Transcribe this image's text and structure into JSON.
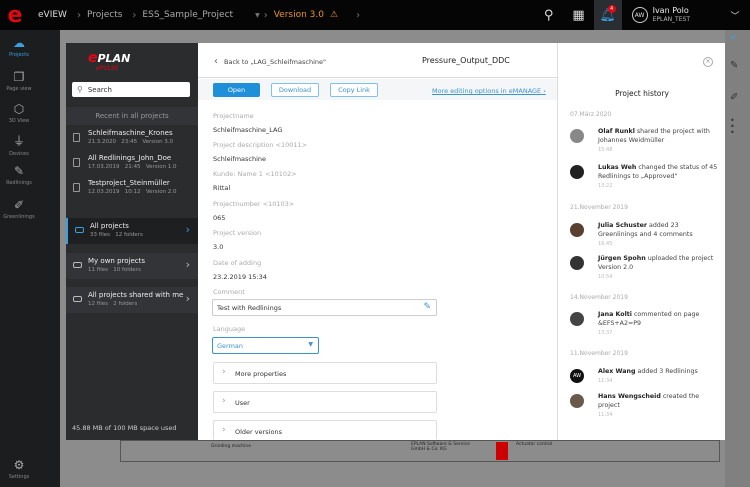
{
  "topbar": {
    "logo": "e",
    "app": "eVIEW",
    "crumbs": [
      "Projects",
      "ESS_Sample_Project"
    ],
    "version": "Version 3.0",
    "notification_count": "4",
    "user_initials": "AW",
    "user_name": "Ivan Polo",
    "user_org": "EPLAN_TEST"
  },
  "rail": {
    "items": [
      {
        "label": "Projects",
        "icon": "cloud-icon"
      },
      {
        "label": "Page view",
        "icon": "pages-icon"
      },
      {
        "label": "3D View",
        "icon": "cube-icon"
      },
      {
        "label": "Devices",
        "icon": "plug-icon"
      },
      {
        "label": "Redlinings",
        "icon": "marker-icon"
      },
      {
        "label": "Greenlinings",
        "icon": "pen-icon"
      }
    ],
    "settings": "Settings"
  },
  "left_panel": {
    "logo": "EPLAN",
    "logo_sub": "ePULSE",
    "search_placeholder": "Search",
    "recent_header": "Recent in all projects",
    "recent": [
      {
        "name": "Schleifmaschine_Krones",
        "meta": "21.3.2020   23:45   Version 3.0"
      },
      {
        "name": "All Redlinings_John_Doe",
        "meta": "17.03.2019   21:45   Version 1.0"
      },
      {
        "name": "Testproject_Steinmüller",
        "meta": "12.03.2019   10:12   Version 2.0"
      }
    ],
    "projects": [
      {
        "name": "All projects",
        "meta": "33 files   12 folders"
      },
      {
        "name": "My own projects",
        "meta": "11 files   10 folders"
      },
      {
        "name": "All projects shared with me",
        "meta": "12 files   2 folders"
      }
    ],
    "space": "45.88 MB of 100 MB space used"
  },
  "dialog": {
    "back": "Back to „LAG_Schleifmaschine\"",
    "title": "Pressure_Output_DDC",
    "buttons": {
      "open": "Open",
      "download": "Download",
      "copy": "Copy Link"
    },
    "more_link": "More editing options in eMANAGE",
    "fields": [
      {
        "label": "Projectname",
        "value": "Schleifmaschine_LAG"
      },
      {
        "label": "Project description <10011>",
        "value": "Schleifmaschine"
      },
      {
        "label": "Kunde: Name 1 <10102>",
        "value": "Rittal"
      },
      {
        "label": "Projectnumber <10103>",
        "value": "065"
      },
      {
        "label": "Project version",
        "value": "3.0"
      },
      {
        "label": "Date of adding",
        "value": "23.2.2019     15:34"
      }
    ],
    "comment_label": "Comment",
    "comment_value": "Test with Redlinings",
    "language_label": "Language",
    "language_value": "German",
    "accordions": [
      "More properties",
      "User",
      "Older versions"
    ]
  },
  "history": {
    "title": "Project history",
    "groups": [
      {
        "date": "07.März 2020",
        "entries": [
          {
            "name": "Olaf Runkl",
            "text": " shared the project with Johannes Weidmüller",
            "time": "15:48"
          },
          {
            "name": "Lukas Weh",
            "text": " changed the status of 45 Redlinings to „Approved\"",
            "time": "13:22"
          }
        ]
      },
      {
        "date": "21.November 2019",
        "entries": [
          {
            "name": "Julia Schuster",
            "text": " added 23 Greenlinings and 4 comments",
            "time": "16:45"
          },
          {
            "name": "Jürgen Spohn",
            "text": " uploaded the project Version 2.0",
            "time": "10:54"
          }
        ]
      },
      {
        "date": "14.November 2019",
        "entries": [
          {
            "name": "Jana Kolti",
            "text": " commented on page &EFS+A2=P9",
            "time": "13:37"
          }
        ]
      },
      {
        "date": "11.November 2019",
        "entries": [
          {
            "name": "Alex Wang",
            "text": " added 3 Redlinings",
            "time": "11:34",
            "initials": "AW"
          },
          {
            "name": "Hans Wengscheid",
            "text": " created the project",
            "time": "11:34"
          }
        ]
      }
    ]
  },
  "sheet": {
    "texts": [
      "Grinding machine",
      "EPLAN Software & Service GmbH & Co. KG",
      "Actuator control"
    ]
  },
  "colors": {
    "accent": "#1e8fd8",
    "brand": "#e30613",
    "warning": "#e8922a"
  }
}
